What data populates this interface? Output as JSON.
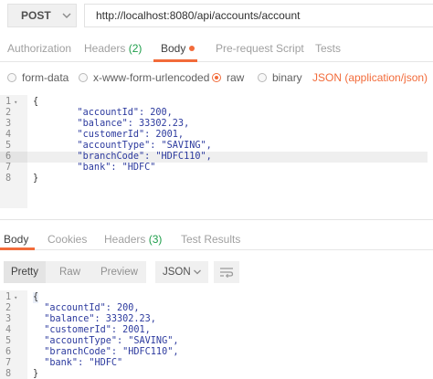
{
  "request": {
    "method": "POST",
    "url": "http://localhost:8080/api/accounts/account"
  },
  "request_tabs": [
    {
      "label": "Authorization",
      "count": ""
    },
    {
      "label": "Headers",
      "count": "(2)"
    },
    {
      "label": "Body",
      "count": ""
    },
    {
      "label": "Pre-request Script",
      "count": ""
    },
    {
      "label": "Tests",
      "count": ""
    }
  ],
  "active_request_tab": "Body",
  "body_modes": [
    {
      "label": "form-data",
      "selected": false
    },
    {
      "label": "x-www-form-urlencoded",
      "selected": false
    },
    {
      "label": "raw",
      "selected": true
    },
    {
      "label": "binary",
      "selected": false
    }
  ],
  "content_type": "JSON (application/json)",
  "request_editor": {
    "line_numbers": [
      "1",
      "2",
      "3",
      "4",
      "5",
      "6",
      "7",
      "8"
    ],
    "highlighted_line": "6",
    "lines": [
      "{",
      "    \"accountId\": 200,",
      "    \"balance\": 33302.23,",
      "    \"customerId\": 2001,",
      "    \"accountType\": \"SAVING\",",
      "    \"branchCode\": \"HDFC110\",",
      "    \"bank\": \"HDFC\"",
      "}"
    ]
  },
  "response_tabs": [
    {
      "label": "Body",
      "count": ""
    },
    {
      "label": "Cookies",
      "count": ""
    },
    {
      "label": "Headers",
      "count": "(3)"
    },
    {
      "label": "Test Results",
      "count": ""
    }
  ],
  "active_response_tab": "Body",
  "view_modes": [
    "Pretty",
    "Raw",
    "Preview"
  ],
  "active_view_mode": "Pretty",
  "format": "JSON",
  "response_editor": {
    "line_numbers": [
      "1",
      "2",
      "3",
      "4",
      "5",
      "6",
      "7",
      "8"
    ],
    "lines": [
      "{",
      "  \"accountId\": 200,",
      "  \"balance\": 33302.23,",
      "  \"customerId\": 2001,",
      "  \"accountType\": \"SAVING\",",
      "  \"branchCode\": \"HDFC110\",",
      "  \"bank\": \"HDFC\"",
      "}"
    ]
  },
  "colors": {
    "accent": "#f26b3a",
    "count": "#1e9e4a",
    "code": "#2c3a9e"
  }
}
